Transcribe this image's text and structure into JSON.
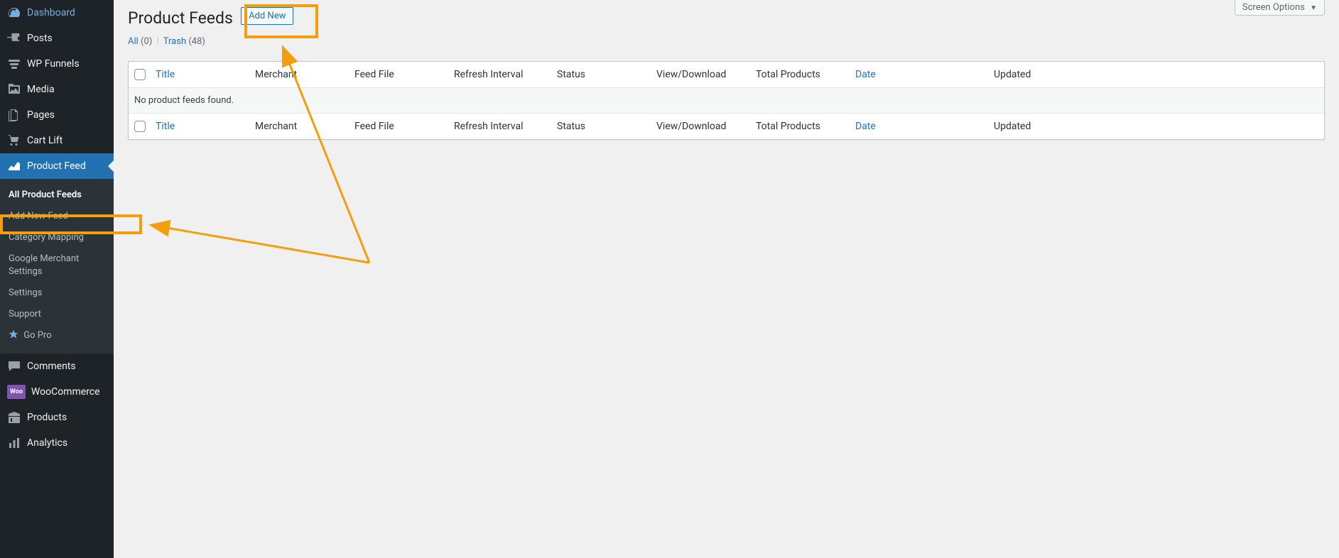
{
  "sidebar": {
    "items": [
      {
        "label": "Dashboard",
        "icon": "dashboard"
      },
      {
        "label": "Posts",
        "icon": "pin"
      },
      {
        "label": "WP Funnels",
        "icon": "funnels"
      },
      {
        "label": "Media",
        "icon": "media"
      },
      {
        "label": "Pages",
        "icon": "pages"
      },
      {
        "label": "Cart Lift",
        "icon": "cart"
      },
      {
        "label": "Product Feed",
        "icon": "chart",
        "active": true
      },
      {
        "label": "Comments",
        "icon": "comment"
      },
      {
        "label": "WooCommerce",
        "icon": "woo"
      },
      {
        "label": "Products",
        "icon": "box"
      },
      {
        "label": "Analytics",
        "icon": "analytics"
      }
    ],
    "submenu": [
      {
        "label": "All Product Feeds",
        "current": true
      },
      {
        "label": "Add New Feed"
      },
      {
        "label": "Category Mapping"
      },
      {
        "label": "Google Merchant Settings"
      },
      {
        "label": "Settings"
      },
      {
        "label": "Support"
      },
      {
        "label": "Go Pro",
        "icon": "star"
      }
    ]
  },
  "header": {
    "title": "Product Feeds",
    "add_new_label": "Add New",
    "screen_options_label": "Screen Options"
  },
  "filters": {
    "all_label": "All",
    "all_count": "(0)",
    "trash_label": "Trash",
    "trash_count": "(48)"
  },
  "table": {
    "columns": {
      "title": "Title",
      "merchant": "Merchant",
      "feedfile": "Feed File",
      "refresh": "Refresh Interval",
      "status": "Status",
      "view": "View/Download",
      "total": "Total Products",
      "date": "Date",
      "updated": "Updated"
    },
    "empty_message": "No product feeds found."
  }
}
